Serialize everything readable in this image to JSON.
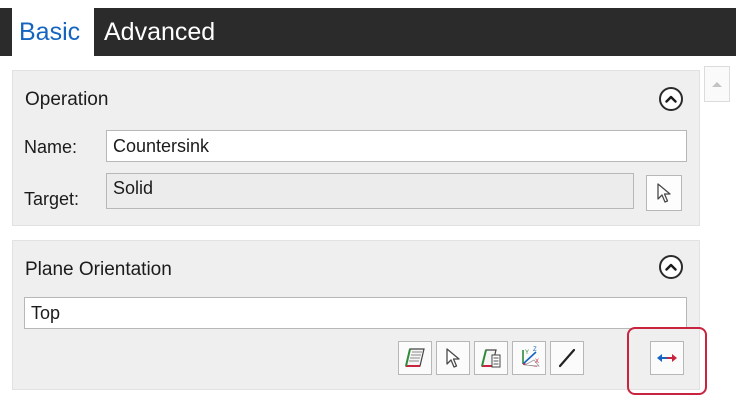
{
  "tabs": {
    "basic": "Basic",
    "advanced": "Advanced"
  },
  "operation": {
    "title": "Operation",
    "name_label": "Name:",
    "name_value": "Countersink",
    "target_label": "Target:",
    "target_value": "Solid"
  },
  "plane_orientation": {
    "title": "Plane Orientation",
    "value": "Top",
    "tools": [
      "plane-icon",
      "select-pointer-icon",
      "plane-from-list-icon",
      "coordinate-system-icon",
      "line-direction-icon",
      "flip-direction-icon"
    ]
  },
  "colors": {
    "accent": "#1565c0",
    "highlight": "#c8233f",
    "tabbar": "#2b2b2b",
    "panel": "#efefef"
  }
}
